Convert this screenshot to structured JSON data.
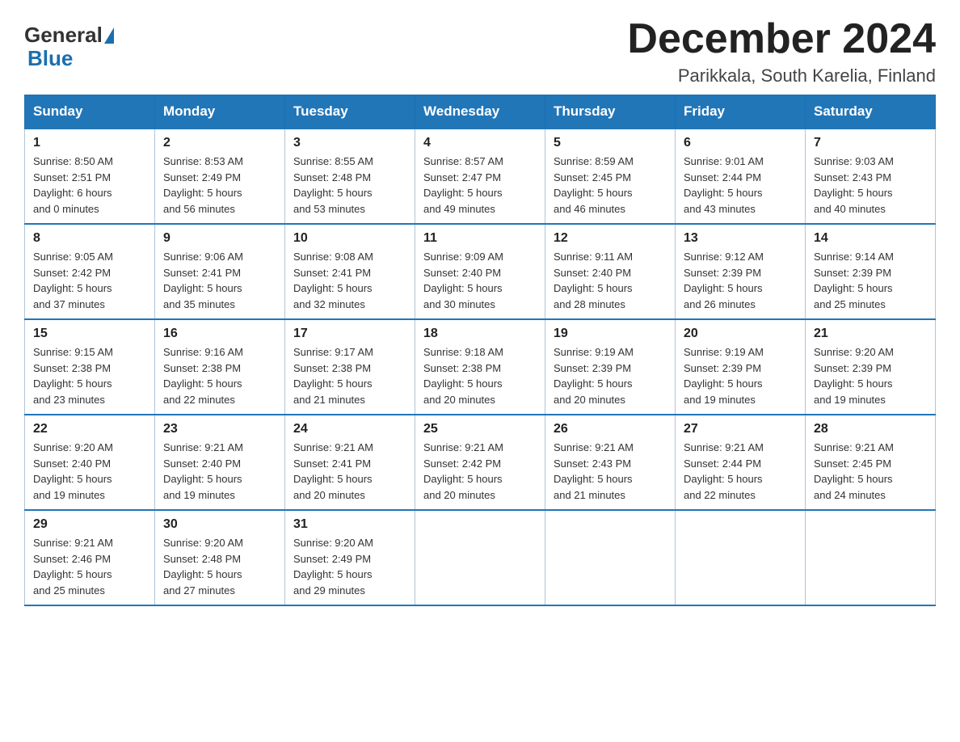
{
  "logo": {
    "general": "General",
    "blue": "Blue"
  },
  "header": {
    "month_year": "December 2024",
    "location": "Parikkala, South Karelia, Finland"
  },
  "weekdays": [
    "Sunday",
    "Monday",
    "Tuesday",
    "Wednesday",
    "Thursday",
    "Friday",
    "Saturday"
  ],
  "weeks": [
    [
      {
        "day": "1",
        "sunrise": "8:50 AM",
        "sunset": "2:51 PM",
        "daylight": "6 hours and 0 minutes"
      },
      {
        "day": "2",
        "sunrise": "8:53 AM",
        "sunset": "2:49 PM",
        "daylight": "5 hours and 56 minutes"
      },
      {
        "day": "3",
        "sunrise": "8:55 AM",
        "sunset": "2:48 PM",
        "daylight": "5 hours and 53 minutes"
      },
      {
        "day": "4",
        "sunrise": "8:57 AM",
        "sunset": "2:47 PM",
        "daylight": "5 hours and 49 minutes"
      },
      {
        "day": "5",
        "sunrise": "8:59 AM",
        "sunset": "2:45 PM",
        "daylight": "5 hours and 46 minutes"
      },
      {
        "day": "6",
        "sunrise": "9:01 AM",
        "sunset": "2:44 PM",
        "daylight": "5 hours and 43 minutes"
      },
      {
        "day": "7",
        "sunrise": "9:03 AM",
        "sunset": "2:43 PM",
        "daylight": "5 hours and 40 minutes"
      }
    ],
    [
      {
        "day": "8",
        "sunrise": "9:05 AM",
        "sunset": "2:42 PM",
        "daylight": "5 hours and 37 minutes"
      },
      {
        "day": "9",
        "sunrise": "9:06 AM",
        "sunset": "2:41 PM",
        "daylight": "5 hours and 35 minutes"
      },
      {
        "day": "10",
        "sunrise": "9:08 AM",
        "sunset": "2:41 PM",
        "daylight": "5 hours and 32 minutes"
      },
      {
        "day": "11",
        "sunrise": "9:09 AM",
        "sunset": "2:40 PM",
        "daylight": "5 hours and 30 minutes"
      },
      {
        "day": "12",
        "sunrise": "9:11 AM",
        "sunset": "2:40 PM",
        "daylight": "5 hours and 28 minutes"
      },
      {
        "day": "13",
        "sunrise": "9:12 AM",
        "sunset": "2:39 PM",
        "daylight": "5 hours and 26 minutes"
      },
      {
        "day": "14",
        "sunrise": "9:14 AM",
        "sunset": "2:39 PM",
        "daylight": "5 hours and 25 minutes"
      }
    ],
    [
      {
        "day": "15",
        "sunrise": "9:15 AM",
        "sunset": "2:38 PM",
        "daylight": "5 hours and 23 minutes"
      },
      {
        "day": "16",
        "sunrise": "9:16 AM",
        "sunset": "2:38 PM",
        "daylight": "5 hours and 22 minutes"
      },
      {
        "day": "17",
        "sunrise": "9:17 AM",
        "sunset": "2:38 PM",
        "daylight": "5 hours and 21 minutes"
      },
      {
        "day": "18",
        "sunrise": "9:18 AM",
        "sunset": "2:38 PM",
        "daylight": "5 hours and 20 minutes"
      },
      {
        "day": "19",
        "sunrise": "9:19 AM",
        "sunset": "2:39 PM",
        "daylight": "5 hours and 20 minutes"
      },
      {
        "day": "20",
        "sunrise": "9:19 AM",
        "sunset": "2:39 PM",
        "daylight": "5 hours and 19 minutes"
      },
      {
        "day": "21",
        "sunrise": "9:20 AM",
        "sunset": "2:39 PM",
        "daylight": "5 hours and 19 minutes"
      }
    ],
    [
      {
        "day": "22",
        "sunrise": "9:20 AM",
        "sunset": "2:40 PM",
        "daylight": "5 hours and 19 minutes"
      },
      {
        "day": "23",
        "sunrise": "9:21 AM",
        "sunset": "2:40 PM",
        "daylight": "5 hours and 19 minutes"
      },
      {
        "day": "24",
        "sunrise": "9:21 AM",
        "sunset": "2:41 PM",
        "daylight": "5 hours and 20 minutes"
      },
      {
        "day": "25",
        "sunrise": "9:21 AM",
        "sunset": "2:42 PM",
        "daylight": "5 hours and 20 minutes"
      },
      {
        "day": "26",
        "sunrise": "9:21 AM",
        "sunset": "2:43 PM",
        "daylight": "5 hours and 21 minutes"
      },
      {
        "day": "27",
        "sunrise": "9:21 AM",
        "sunset": "2:44 PM",
        "daylight": "5 hours and 22 minutes"
      },
      {
        "day": "28",
        "sunrise": "9:21 AM",
        "sunset": "2:45 PM",
        "daylight": "5 hours and 24 minutes"
      }
    ],
    [
      {
        "day": "29",
        "sunrise": "9:21 AM",
        "sunset": "2:46 PM",
        "daylight": "5 hours and 25 minutes"
      },
      {
        "day": "30",
        "sunrise": "9:20 AM",
        "sunset": "2:48 PM",
        "daylight": "5 hours and 27 minutes"
      },
      {
        "day": "31",
        "sunrise": "9:20 AM",
        "sunset": "2:49 PM",
        "daylight": "5 hours and 29 minutes"
      },
      null,
      null,
      null,
      null
    ]
  ],
  "labels": {
    "sunrise": "Sunrise:",
    "sunset": "Sunset:",
    "daylight": "Daylight:"
  }
}
